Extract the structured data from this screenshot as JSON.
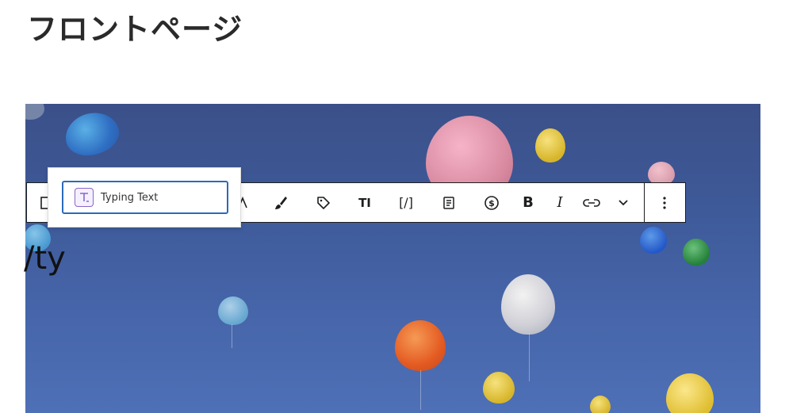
{
  "page": {
    "title": "フロントページ"
  },
  "editor": {
    "typed_text": "/ty"
  },
  "block_inserter": {
    "items": [
      {
        "label": "Typing Text",
        "icon": "typing-text-icon"
      }
    ]
  },
  "toolbar": {
    "bold_label": "B",
    "italic_label": "I",
    "text_size_label": "TI",
    "shortcode_label": "[/]",
    "buttons": [
      "block-type-icon",
      "text-color-icon",
      "highlight-brush-icon",
      "tag-icon",
      "font-size-icon",
      "shortcode-icon",
      "document-icon",
      "money-icon",
      "bold-icon",
      "italic-icon",
      "link-icon",
      "more-formatting-icon",
      "options-icon"
    ]
  },
  "colors": {
    "accent": "#2b6bb8",
    "icon_purple": "#8a66c9"
  }
}
